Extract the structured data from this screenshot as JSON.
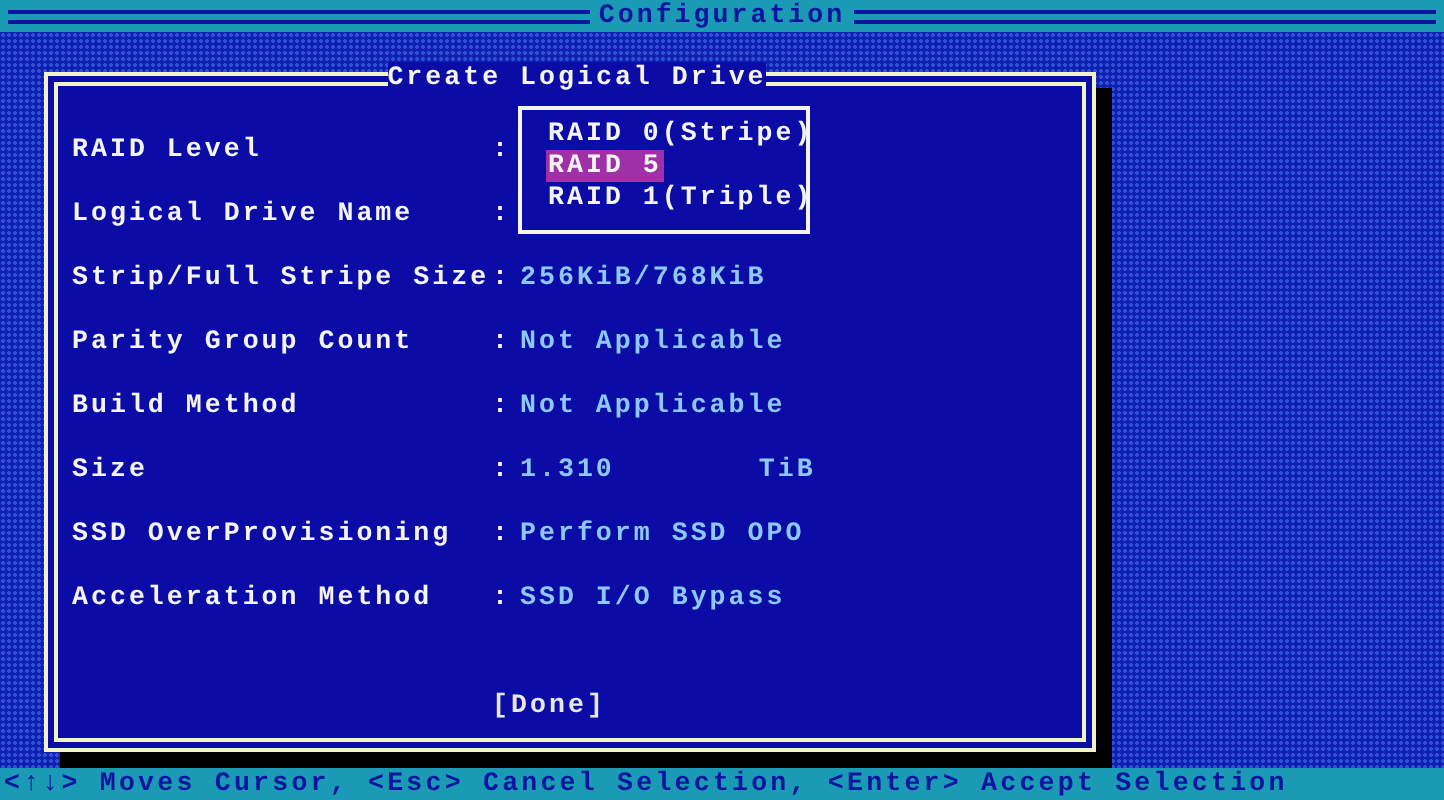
{
  "top_bar": {
    "title": "Configuration"
  },
  "dialog": {
    "title": "Create Logical Drive",
    "fields": [
      {
        "label": "RAID Level",
        "separator": ":"
      },
      {
        "label": "Logical Drive Name",
        "separator": ":"
      },
      {
        "label": "Strip/Full Stripe Size",
        "separator": ":",
        "value": "256KiB/768KiB"
      },
      {
        "label": "Parity Group Count",
        "separator": ":",
        "value": "Not Applicable"
      },
      {
        "label": "Build Method",
        "separator": ":",
        "value": "Not Applicable"
      },
      {
        "label": "Size",
        "separator": ":",
        "value": "1.310",
        "unit": "TiB"
      },
      {
        "label": "SSD OverProvisioning",
        "separator": ":",
        "value": "Perform SSD OPO"
      },
      {
        "label": "Acceleration Method",
        "separator": ":",
        "value": "SSD I/O Bypass"
      }
    ],
    "done_button": "[Done]"
  },
  "dropdown": {
    "options": [
      {
        "label": "RAID 0(Stripe)",
        "selected": false
      },
      {
        "label": "RAID 5",
        "selected": true
      },
      {
        "label": "RAID 1(Triple)",
        "selected": false
      }
    ]
  },
  "status_bar": {
    "text": "<↑↓> Moves Cursor, <Esc> Cancel Selection, <Enter> Accept Selection"
  }
}
